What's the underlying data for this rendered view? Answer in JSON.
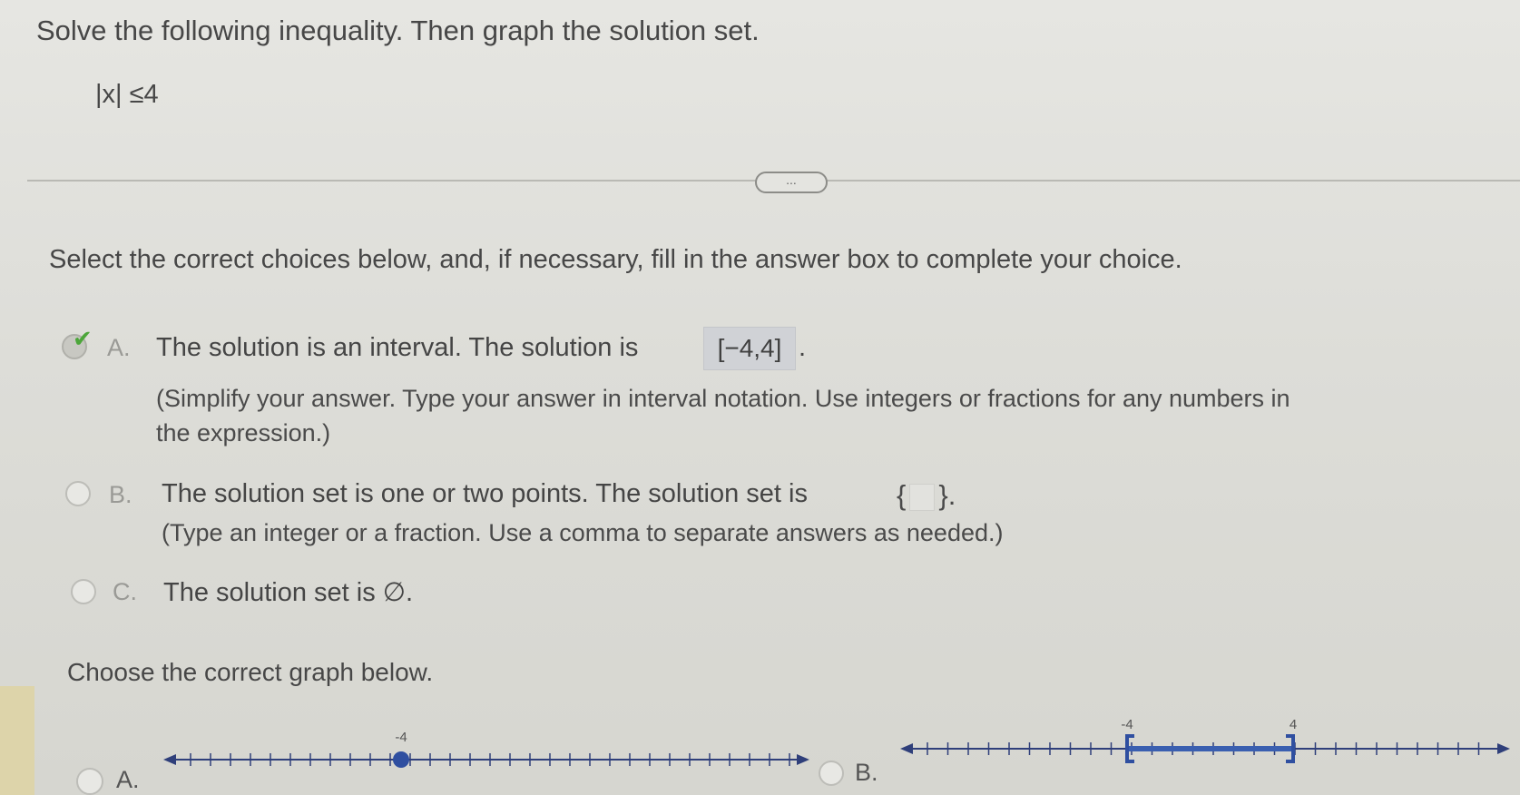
{
  "question": {
    "prompt": "Solve the following inequality. Then graph the solution set.",
    "inequality": "|x| ≤4"
  },
  "more_button": {
    "label": "..."
  },
  "instructions": "Select the correct choices below, and, if necessary, fill in the answer box to complete your choice.",
  "choices": [
    {
      "letter": "A.",
      "text": "The solution is an interval. The solution is",
      "answer": "[−4,4]",
      "hint_line1": "(Simplify your answer. Type your answer in interval notation. Use integers or fractions for any numbers in",
      "hint_line2": "the expression.)",
      "selected": true
    },
    {
      "letter": "B.",
      "text": "The solution set is one or two points. The solution set is",
      "set_open": "{",
      "set_close": "}.",
      "hint": "(Type an integer or a fraction. Use a comma to separate answers as needed.)",
      "selected": false
    },
    {
      "letter": "C.",
      "text": "The solution set is ∅.",
      "selected": false
    }
  ],
  "graph_prompt": "Choose the correct graph below.",
  "graph_options": [
    {
      "letter": "A.",
      "tick_label": "-4",
      "type": "single-point",
      "point": -4
    },
    {
      "letter": "B.",
      "left_label": "-4",
      "right_label": "4",
      "type": "closed-interval",
      "interval": [
        -4,
        4
      ]
    }
  ],
  "colors": {
    "check": "#4ca63a",
    "line": "#2f3f7a",
    "interval": "#3a5fb0",
    "answer_box": "#d0d2d6"
  },
  "icons": {
    "check": "check-icon",
    "more": "ellipsis-icon"
  }
}
